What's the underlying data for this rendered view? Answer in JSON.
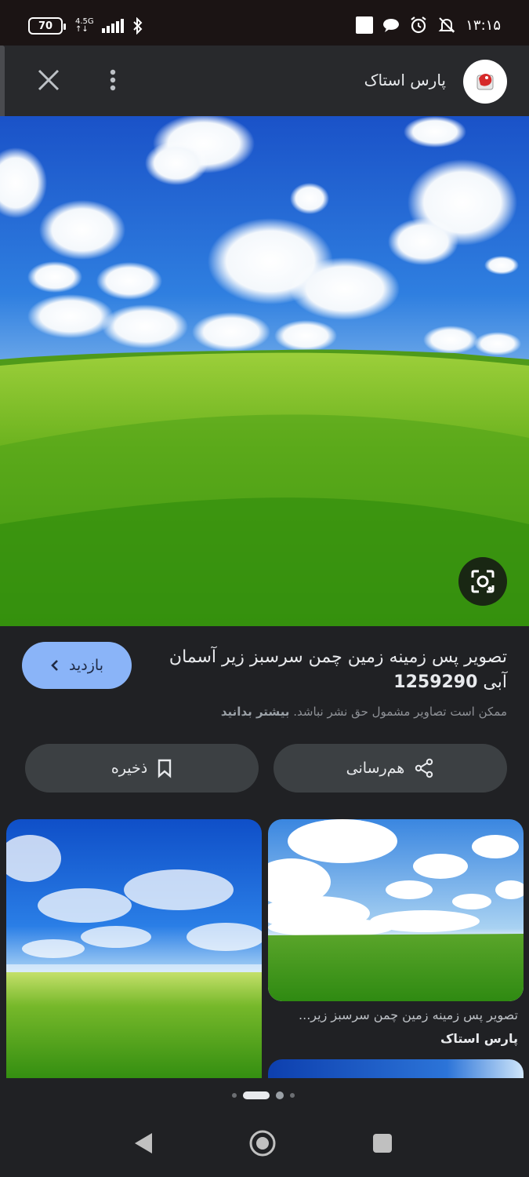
{
  "status_bar": {
    "battery": "70",
    "network": "4.5G",
    "time": "۱۳:۱۵"
  },
  "header": {
    "site_name": "پارس استاک",
    "close_icon": "close-icon",
    "menu_icon": "more-vert-icon"
  },
  "main": {
    "title_line1": "تصویر پس زمینه زمین چمن سرسبز زیر آسمان",
    "title_line2_text": "آبی",
    "title_line2_number": "1259290",
    "visit_label": "بازدید",
    "copyright_text": "ممکن است تصاویر مشمول حق نشر نباشد.",
    "learn_more": "بیشتر بدانید",
    "share_label": "هم‌رسانی",
    "save_label": "ذخیره"
  },
  "related": [
    {
      "caption": "",
      "source": ""
    },
    {
      "caption": "تصویر پس زمینه زمین چمن سرسبز زیر...",
      "source": "پارس استاک"
    }
  ],
  "colors": {
    "background": "#202124",
    "accent": "#8ab4f8",
    "button": "#3c4043"
  }
}
